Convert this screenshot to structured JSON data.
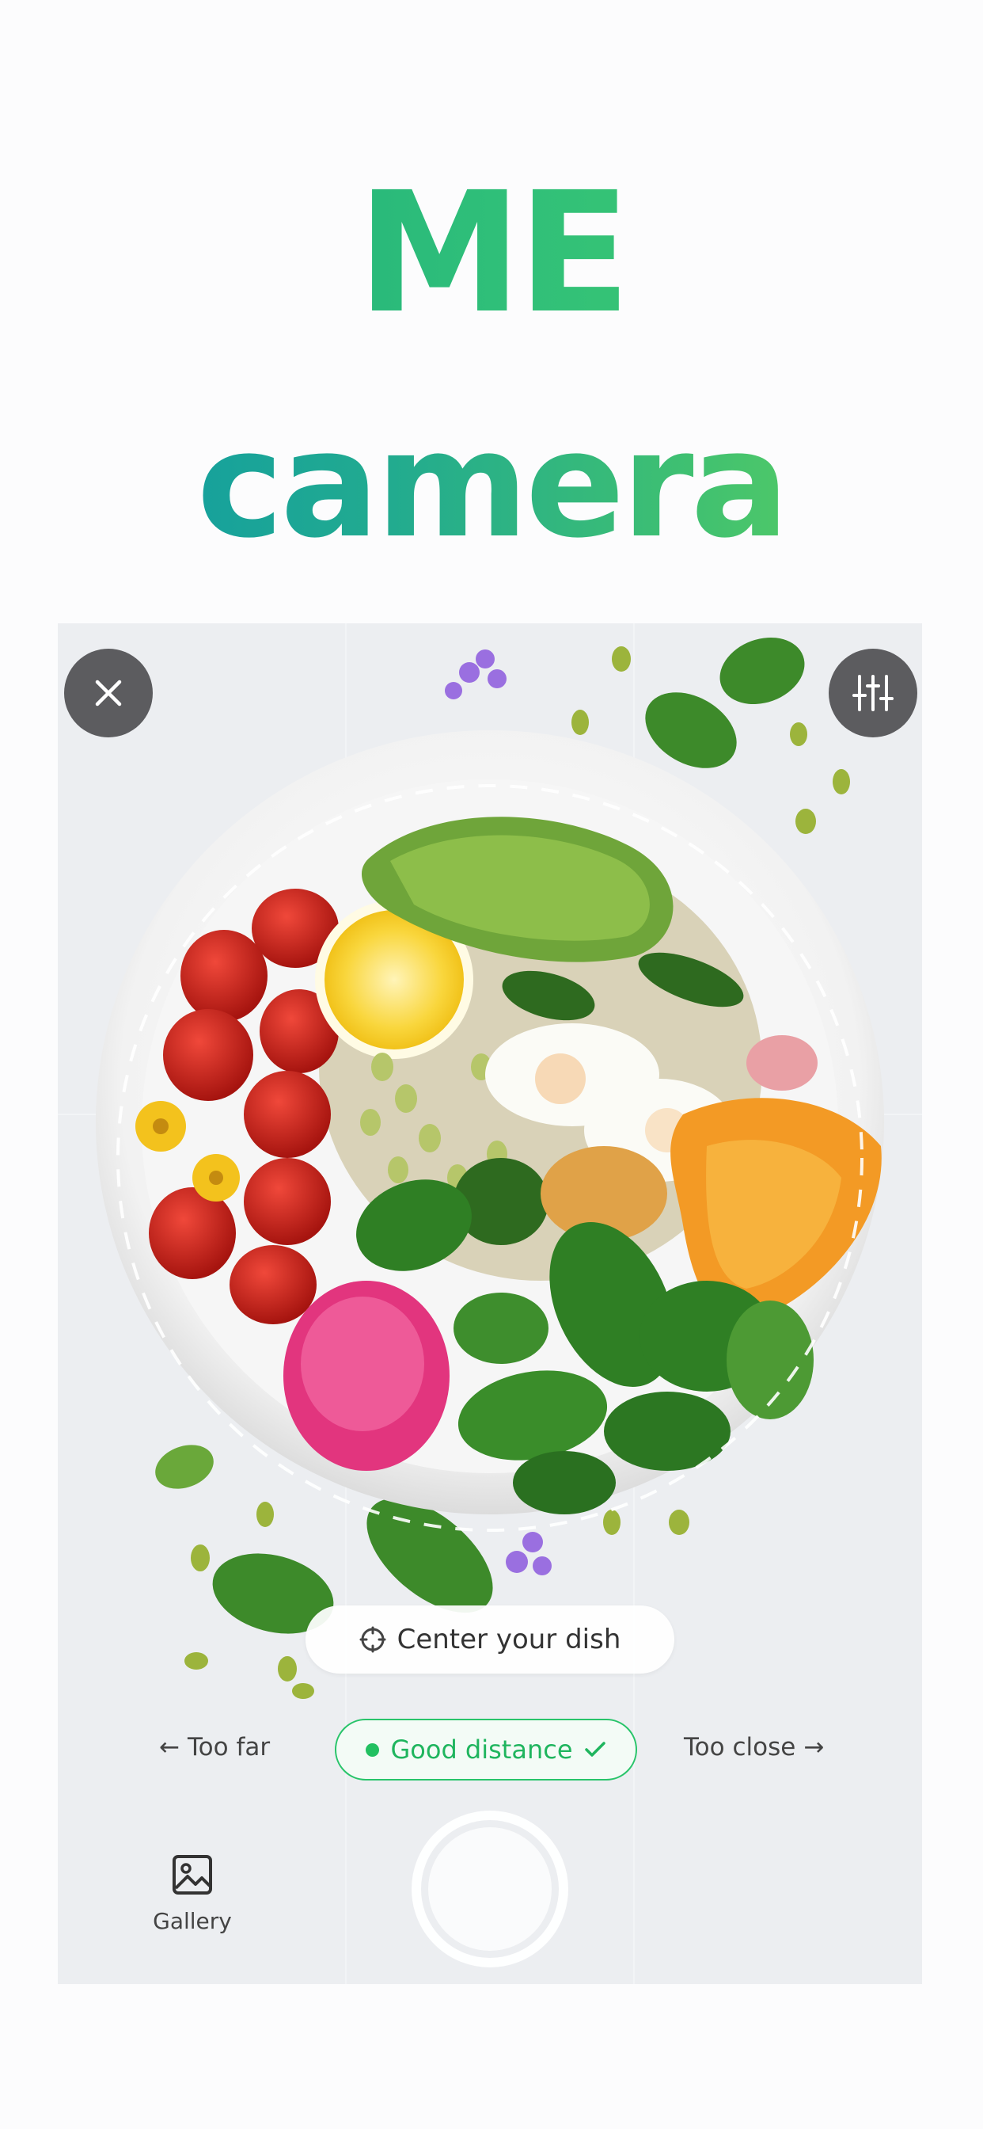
{
  "hero": {
    "line1": "ME",
    "line2": "camera"
  },
  "camera": {
    "close_icon": "close-icon",
    "settings_icon": "sliders-icon",
    "hint": {
      "icon": "crosshair-icon",
      "label": "Center your dish"
    },
    "distance": {
      "too_far": "Too far",
      "good": "Good distance",
      "too_close": "Too close",
      "good_color": "#22c061"
    },
    "gallery": {
      "icon": "image-icon",
      "label": "Gallery"
    },
    "shutter": "shutter-button"
  },
  "colors": {
    "accent": "#22c061",
    "title_start": "#0b98a8",
    "title_end": "#6ad65a"
  }
}
